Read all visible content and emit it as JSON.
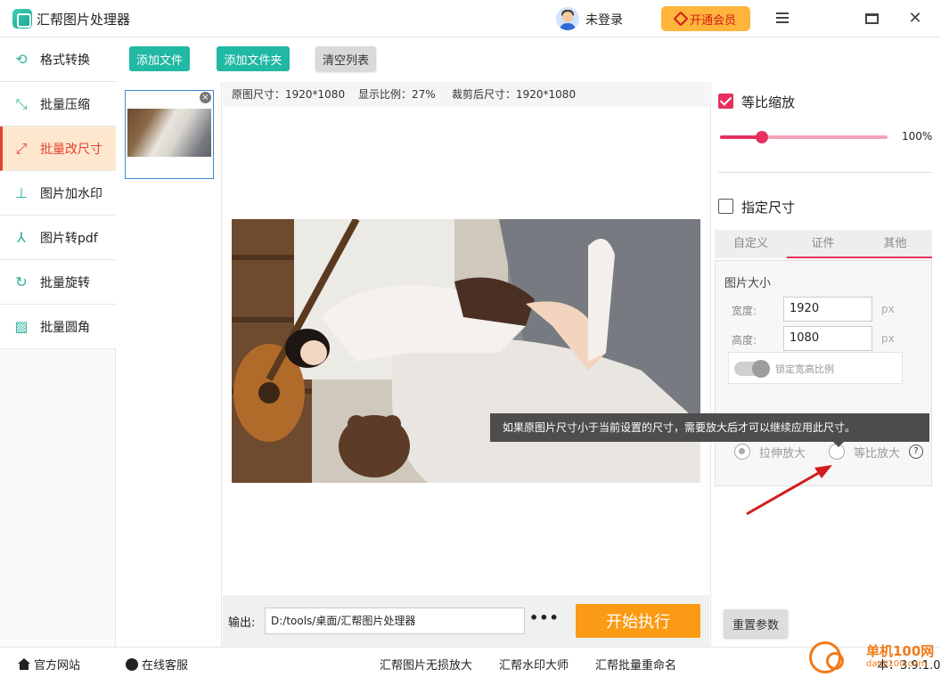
{
  "app": {
    "title": "汇帮图片处理器",
    "login_text": "未登录",
    "vip_label": "开通会员"
  },
  "sidebar": {
    "items": [
      {
        "label": "格式转换",
        "icon": "format-convert-icon"
      },
      {
        "label": "批量压缩",
        "icon": "compress-icon"
      },
      {
        "label": "批量改尺寸",
        "icon": "resize-icon"
      },
      {
        "label": "图片加水印",
        "icon": "watermark-icon"
      },
      {
        "label": "图片转pdf",
        "icon": "pdf-icon"
      },
      {
        "label": "批量旋转",
        "icon": "rotate-icon"
      },
      {
        "label": "批量圆角",
        "icon": "round-corner-icon"
      }
    ],
    "active_index": 2
  },
  "toolbar": {
    "add_file": "添加文件",
    "add_folder": "添加文件夹",
    "clear_list": "清空列表"
  },
  "thumbnail": {
    "close_glyph": "×"
  },
  "info": {
    "original_size": "原图尺寸：1920*1080",
    "display_ratio": "显示比例：27%",
    "cropped_size": "裁剪后尺寸：1920*1080"
  },
  "output": {
    "label": "输出:",
    "path": "D:/tools/桌面/汇帮图片处理器",
    "more": "•••",
    "start_label": "开始执行"
  },
  "settings": {
    "proportional_scale": {
      "label": "等比缩放",
      "checked": true
    },
    "scale_percent": 0.25,
    "scale_value_text": "100%",
    "specify_size": {
      "label": "指定尺寸",
      "checked": false
    },
    "tabs": [
      "自定义",
      "证件",
      "其他"
    ],
    "active_tab": 0,
    "image_size_title": "图片大小",
    "width": {
      "label": "宽度:",
      "value": "1920",
      "unit": "px"
    },
    "height": {
      "label": "高度:",
      "value": "1080",
      "unit": "px"
    },
    "lock_ratio_label": "锁定宽高比例",
    "stretch_label": "拉伸放大",
    "proportional_enlarge_label": "等比放大",
    "help_glyph": "?",
    "reset_label": "重置参数"
  },
  "tooltip": {
    "text": "如果原图片尺寸小于当前设置的尺寸，需要放大后才可以继续应用此尺寸。"
  },
  "footer": {
    "website": "官方网站",
    "service": "在线客服",
    "link1": "汇帮图片无损放大",
    "link2": "汇帮水印大师",
    "link3": "汇帮批量重命名",
    "version": "本：3.9.1.0"
  },
  "watermark": {
    "line1": "单机100网",
    "line2": "danji100.com"
  },
  "colors": {
    "accent_teal": "#21b8a4",
    "accent_pink": "#e6315d",
    "start_orange": "#fb9a14",
    "vip_orange": "#ffb43b",
    "active_red": "#e8402f"
  }
}
